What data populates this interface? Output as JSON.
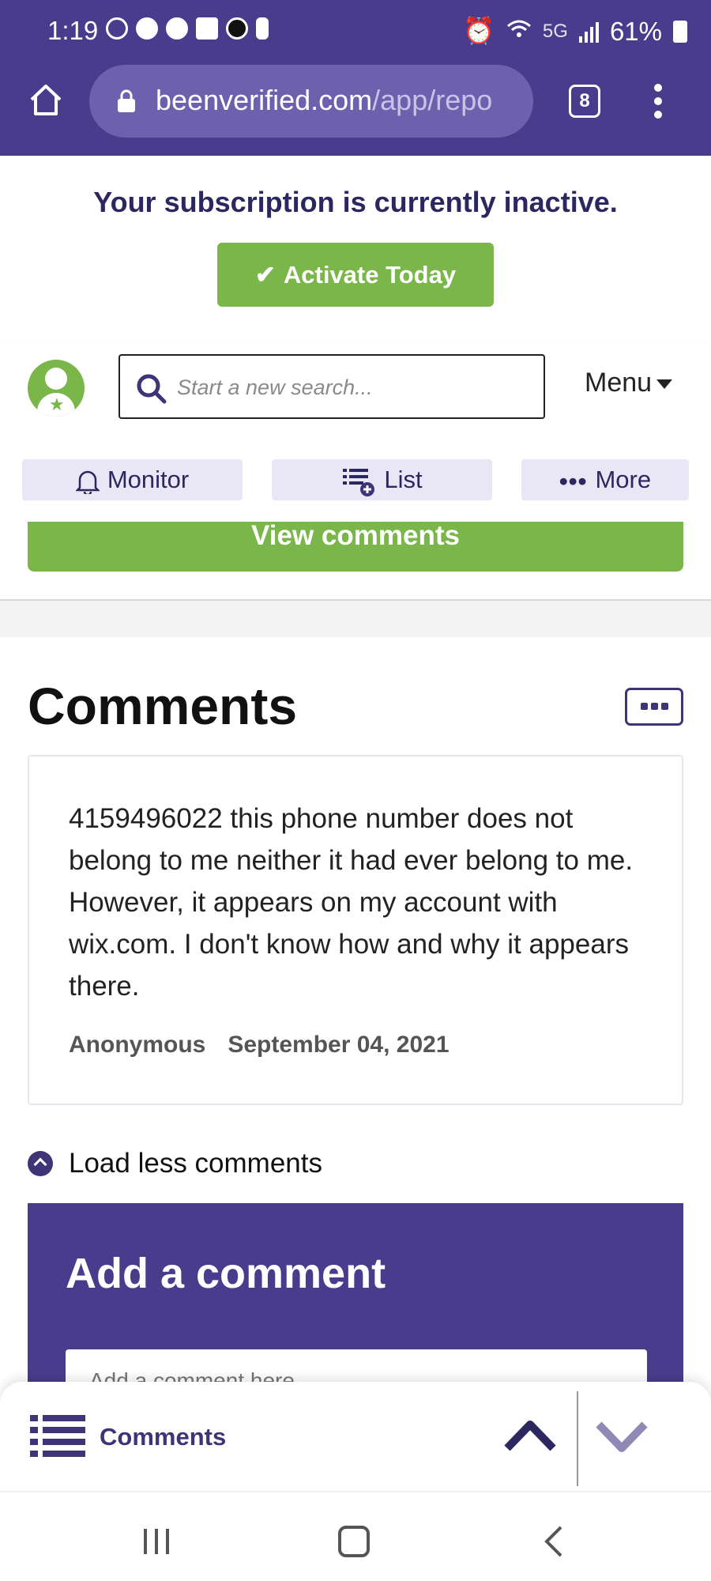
{
  "status_bar": {
    "time": "1:19",
    "network": "5G",
    "battery": "61%"
  },
  "browser": {
    "url_main": "beenverified.com",
    "url_path": "/app/repo",
    "tab_count": "8"
  },
  "banner": {
    "message": "Your subscription is currently inactive.",
    "activate_label": "Activate Today"
  },
  "header": {
    "search_placeholder": "Start a new search...",
    "menu_label": "Menu"
  },
  "actions": {
    "monitor": "Monitor",
    "list": "List",
    "more": "More"
  },
  "main": {
    "view_comments_label": "View comments",
    "comments_title": "Comments",
    "comment": {
      "text": "4159496022 this phone number does not belong to me neither it had ever belong to me. However, it appears on my account with wix.com. I don't know how and why it appears there.",
      "author": "Anonymous",
      "date": "September 04, 2021"
    },
    "load_less_label": "Load less comments",
    "add_comment_title": "Add a comment",
    "add_comment_placeholder": "Add a comment here"
  },
  "bottom_sheet": {
    "label": "Comments"
  },
  "colors": {
    "brand_purple": "#4a3c8c",
    "accent_green": "#7bb64b",
    "dark_purple": "#3d3577"
  }
}
